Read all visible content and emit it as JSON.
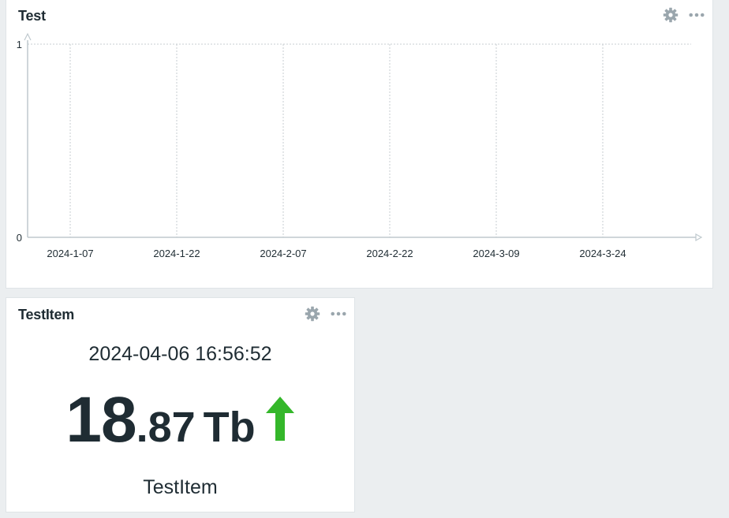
{
  "graph_widget": {
    "title": "Test",
    "actions": [
      "gear-icon",
      "more-icon"
    ]
  },
  "item_widget": {
    "title": "TestItem",
    "timestamp": "2024-04-06 16:56:52",
    "value_int": "18",
    "value_dec": ".87",
    "unit": "Tb",
    "trend": "up",
    "description": "TestItem",
    "actions": [
      "gear-icon",
      "more-icon"
    ]
  },
  "colors": {
    "trend_up": "#34b72a",
    "axis": "#bfc9ce",
    "grid": "#c7cdd1",
    "icon": "#9aa6ad"
  },
  "chart_data": {
    "type": "line",
    "title": "Test",
    "x_ticks": [
      "2024-1-07",
      "2024-1-22",
      "2024-2-07",
      "2024-2-22",
      "2024-3-09",
      "2024-3-24"
    ],
    "y_ticks": [
      "0",
      "1"
    ],
    "ylim": [
      0,
      1
    ],
    "series": [],
    "grid": true
  }
}
